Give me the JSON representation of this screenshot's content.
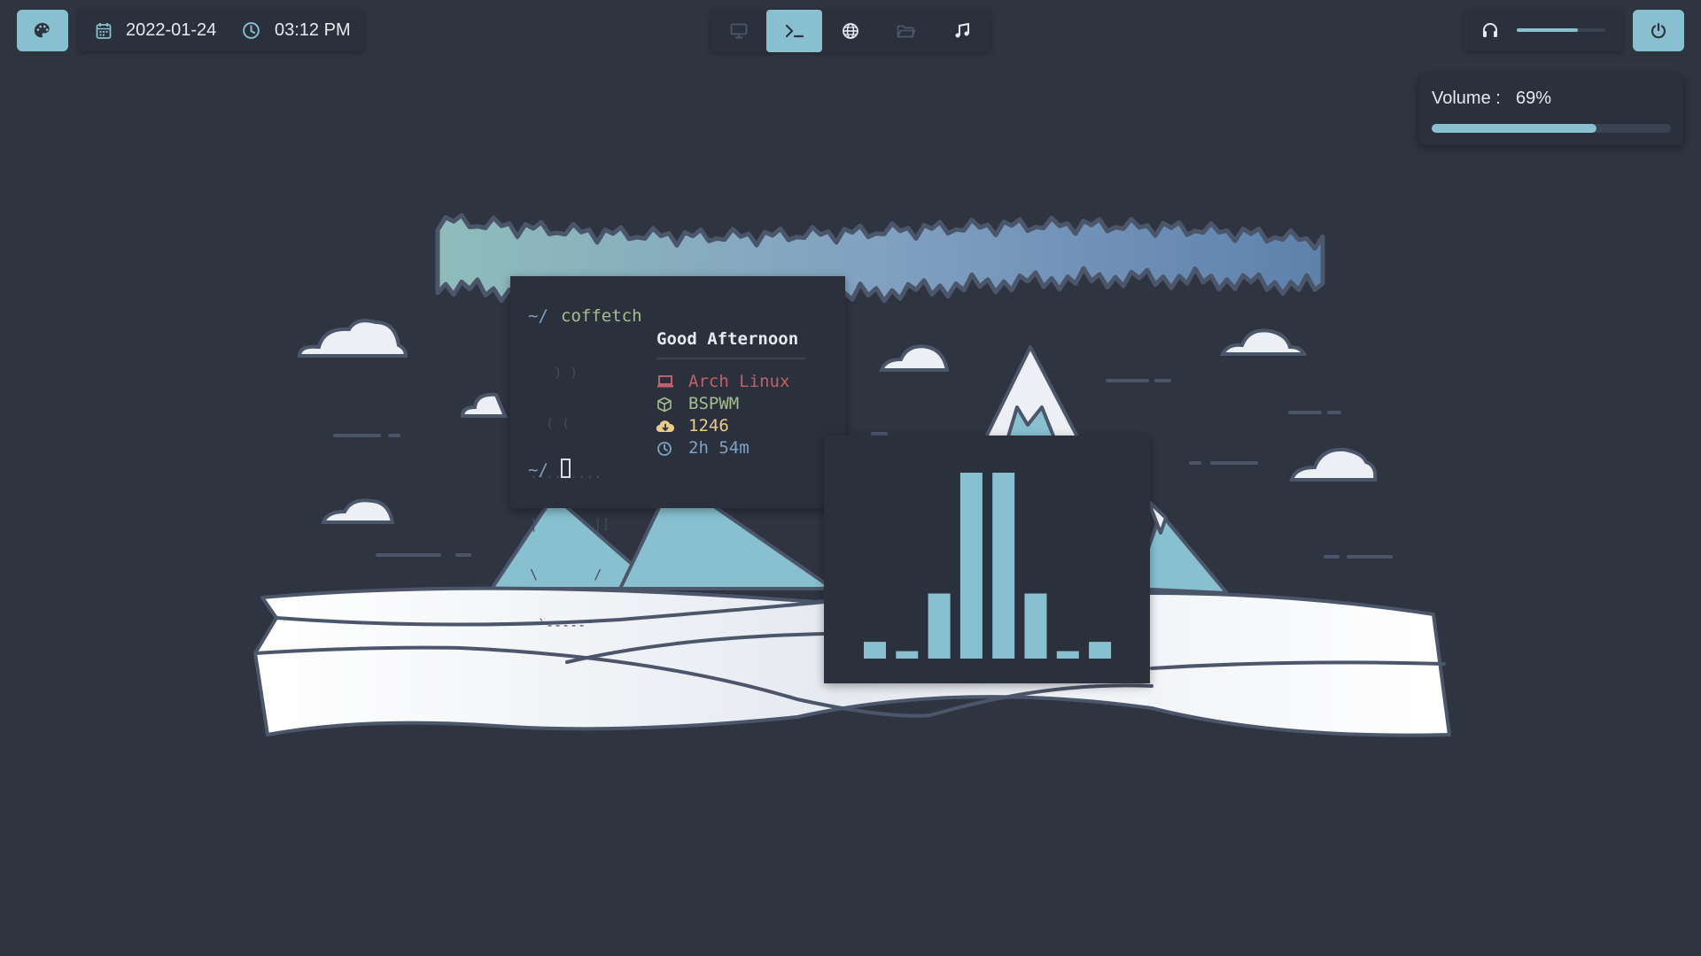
{
  "topbar": {
    "date": "2022-01-24",
    "time": "03:12 PM",
    "workspaces": [
      {
        "name": "monitor-icon",
        "active": false
      },
      {
        "name": "terminal-icon",
        "active": true
      },
      {
        "name": "globe-icon",
        "active": false
      },
      {
        "name": "folder-icon",
        "active": false
      },
      {
        "name": "music-note-icon",
        "active": false
      }
    ],
    "volume_slider_percent": 69
  },
  "volume_popup": {
    "label": "Volume :",
    "value": "69%",
    "percent": 69
  },
  "terminal": {
    "prompt1": "~/",
    "command": "coffetch",
    "art": [
      "   ) )",
      "  ( (",
      ".........",
      "|       |]",
      "\\       /",
      " `-----'"
    ],
    "greeting": "Good Afternoon",
    "os": "Arch Linux",
    "wm": "BSPWM",
    "packages": "1246",
    "uptime": "2h 54m",
    "prompt2": "~/"
  },
  "visualizer": {
    "levels": [
      0.09,
      0.04,
      0.35,
      1.0,
      1.0,
      0.35,
      0.04,
      0.09
    ]
  },
  "colors": {
    "background": "#2e3440",
    "accent": "#88c0d0",
    "red": "#bf616a",
    "green": "#a3be8c",
    "yellow": "#ebcb8b",
    "blue": "#81a1c1"
  }
}
